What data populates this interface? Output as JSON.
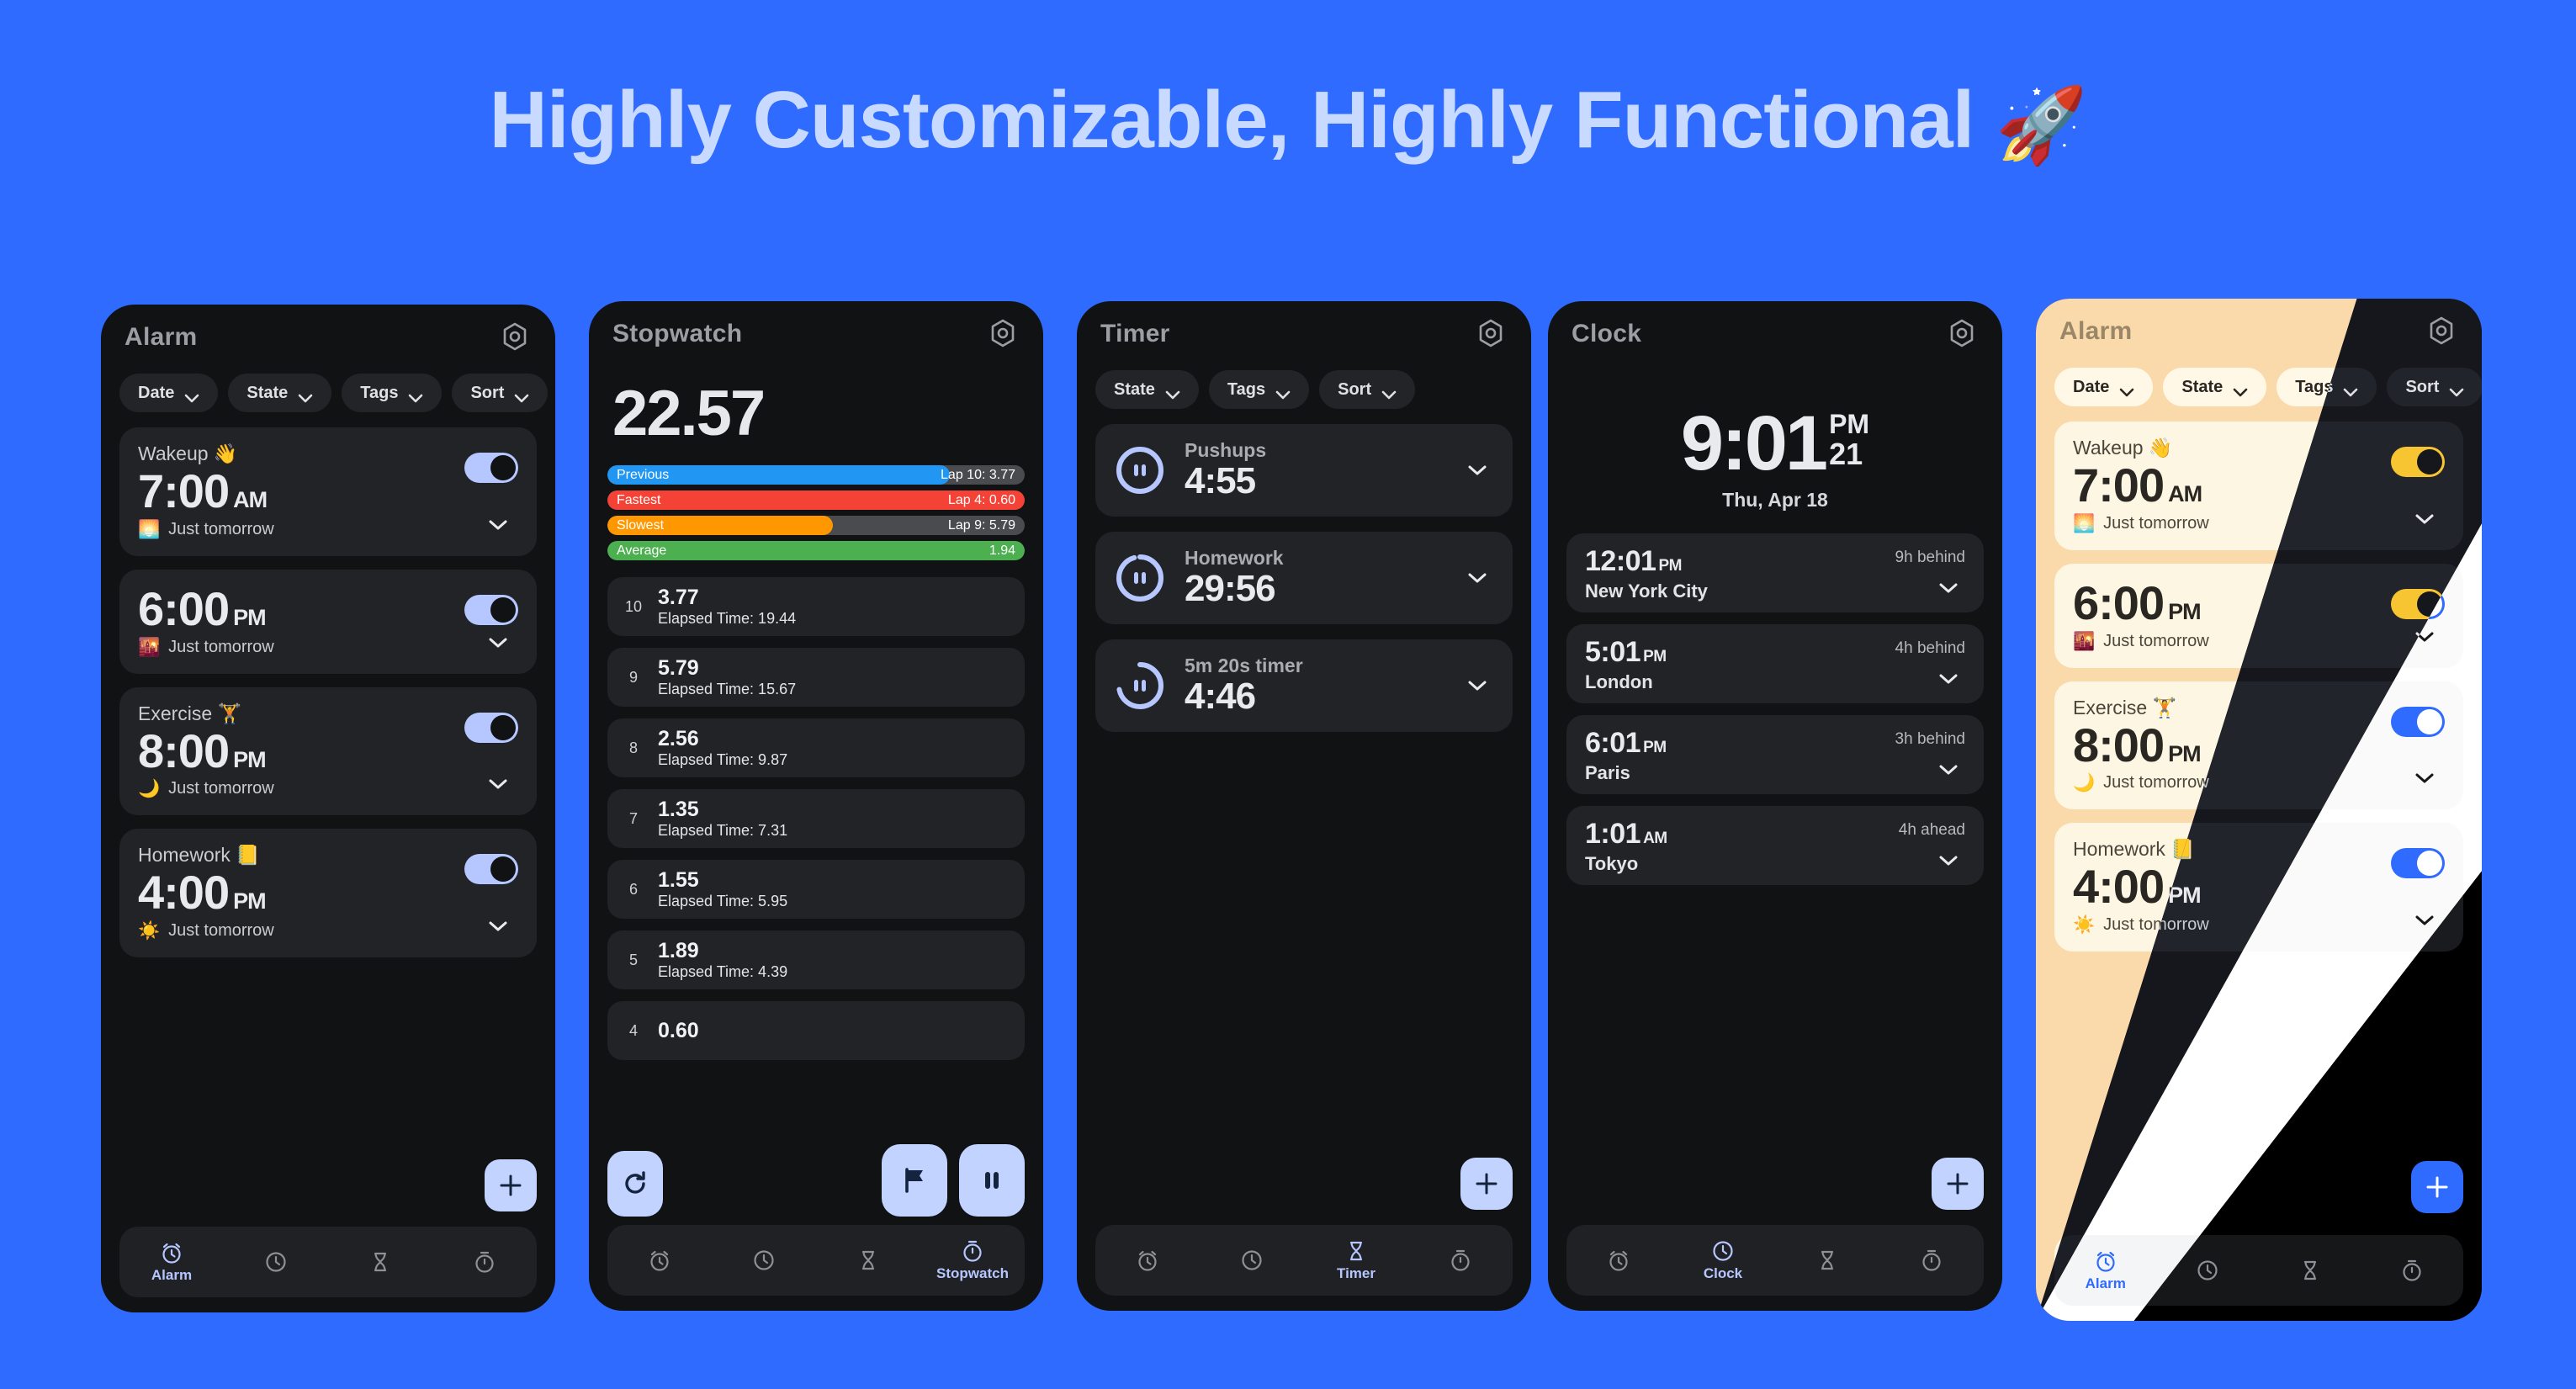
{
  "headline": {
    "text": "Highly Customizable, Highly Functional ",
    "emoji": "🚀"
  },
  "brand": {
    "background": "#2f6bff",
    "accent_light": "#c2d3ff",
    "accent_blue": "#2f6bff",
    "accent_yellow": "#f7c531"
  },
  "nav": {
    "items": [
      {
        "icon": "alarm-clock-icon",
        "label": "Alarm"
      },
      {
        "icon": "clock-icon",
        "label": "Clock"
      },
      {
        "icon": "hourglass-icon",
        "label": "Timer"
      },
      {
        "icon": "stopwatch-icon",
        "label": "Stopwatch"
      }
    ]
  },
  "alarm_screen": {
    "title": "Alarm",
    "settings_icon": "gear-icon",
    "chips": [
      {
        "label": "Date",
        "icon": "chevron-down-icon"
      },
      {
        "label": "State",
        "icon": "chevron-down-icon"
      },
      {
        "label": "Tags",
        "icon": "chevron-down-icon"
      },
      {
        "label": "Sort",
        "icon": "chevron-down-icon"
      }
    ],
    "alarms": [
      {
        "label": "Wakeup 👋",
        "time": "7:00",
        "meridiem": "AM",
        "sub_icon": "🌅",
        "sub": "Just tomorrow",
        "enabled": true
      },
      {
        "label": "",
        "time": "6:00",
        "meridiem": "PM",
        "sub_icon": "🌇",
        "sub": "Just tomorrow",
        "enabled": true
      },
      {
        "label": "Exercise 🏋️",
        "time": "8:00",
        "meridiem": "PM",
        "sub_icon": "🌙",
        "sub": "Just tomorrow",
        "enabled": true
      },
      {
        "label": "Homework 📒",
        "time": "4:00",
        "meridiem": "PM",
        "sub_icon": "☀️",
        "sub": "Just tomorrow",
        "enabled": true
      }
    ],
    "add_button": "add-alarm-button",
    "active_nav": "Alarm"
  },
  "stopwatch_screen": {
    "title": "Stopwatch",
    "settings_icon": "gear-icon",
    "elapsed": "22.57",
    "bars": [
      {
        "name": "Previous",
        "value": "Lap 10: 3.77",
        "color": "#2196f3",
        "fill_pct": 82
      },
      {
        "name": "Fastest",
        "value": "Lap 4: 0.60",
        "color": "#f44336",
        "fill_pct": 100
      },
      {
        "name": "Slowest",
        "value": "Lap 9: 5.79",
        "color": "#ff9800",
        "fill_pct": 54
      },
      {
        "name": "Average",
        "value": "1.94",
        "color": "#4caf50",
        "fill_pct": 100
      }
    ],
    "laps": [
      {
        "num": "10",
        "value": "3.77",
        "elapsed": "Elapsed Time: 19.44"
      },
      {
        "num": "9",
        "value": "5.79",
        "elapsed": "Elapsed Time: 15.67"
      },
      {
        "num": "8",
        "value": "2.56",
        "elapsed": "Elapsed Time: 9.87"
      },
      {
        "num": "7",
        "value": "1.35",
        "elapsed": "Elapsed Time: 7.31"
      },
      {
        "num": "6",
        "value": "1.55",
        "elapsed": "Elapsed Time: 5.95"
      },
      {
        "num": "5",
        "value": "1.89",
        "elapsed": "Elapsed Time: 4.39"
      },
      {
        "num": "4",
        "value": "0.60",
        "elapsed": ""
      }
    ],
    "buttons": [
      {
        "name": "reset-button",
        "icon": "refresh-icon"
      },
      {
        "name": "lap-button",
        "icon": "flag-icon"
      },
      {
        "name": "pause-button",
        "icon": "pause-icon"
      }
    ],
    "active_nav": "Stopwatch"
  },
  "timer_screen": {
    "title": "Timer",
    "settings_icon": "gear-icon",
    "chips": [
      {
        "label": "State",
        "icon": "chevron-down-icon"
      },
      {
        "label": "Tags",
        "icon": "chevron-down-icon"
      },
      {
        "label": "Sort",
        "icon": "chevron-down-icon"
      }
    ],
    "timers": [
      {
        "name": "Pushups",
        "time": "4:55",
        "state_icon": "pause-ring-icon",
        "progress_pct": 78
      },
      {
        "name": "Homework",
        "time": "29:56",
        "state_icon": "pause-ring-icon",
        "progress_pct": 96
      },
      {
        "name": "5m 20s timer",
        "time": "4:46",
        "state_icon": "pause-ring-icon",
        "progress_pct": 72
      }
    ],
    "add_button": "add-timer-button",
    "active_nav": "Timer"
  },
  "clock_screen": {
    "title": "Clock",
    "settings_icon": "gear-icon",
    "time": "9:01",
    "meridiem": "PM",
    "seconds": "21",
    "date": "Thu, Apr 18",
    "world_clocks": [
      {
        "time": "12:01",
        "meridiem": "PM",
        "city": "New York City",
        "offset": "9h behind"
      },
      {
        "time": "5:01",
        "meridiem": "PM",
        "city": "London",
        "offset": "4h behind"
      },
      {
        "time": "6:01",
        "meridiem": "PM",
        "city": "Paris",
        "offset": "3h behind"
      },
      {
        "time": "1:01",
        "meridiem": "AM",
        "city": "Tokyo",
        "offset": "4h ahead"
      }
    ],
    "add_button": "add-world-clock-button",
    "active_nav": "Clock"
  },
  "themed_alarm_screen": {
    "title": "Alarm",
    "settings_icon": "gear-icon",
    "chips": [
      {
        "label": "Date",
        "icon": "chevron-down-icon"
      },
      {
        "label": "State",
        "icon": "chevron-down-icon"
      },
      {
        "label": "Tags",
        "icon": "chevron-down-icon"
      },
      {
        "label": "Sort",
        "icon": "chevron-down-icon"
      }
    ],
    "alarms": [
      {
        "label": "Wakeup 👋",
        "time": "7:00",
        "meridiem": "AM",
        "sub_icon": "🌅",
        "sub": "Just tomorrow",
        "enabled": true
      },
      {
        "label": "",
        "time": "6:00",
        "meridiem": "PM",
        "sub_icon": "🌇",
        "sub": "Just tomorrow",
        "enabled": true
      },
      {
        "label": "Exercise 🏋️",
        "time": "8:00",
        "meridiem": "PM",
        "sub_icon": "🌙",
        "sub": "Just tomorrow",
        "enabled": true
      },
      {
        "label": "Homework 📒",
        "time": "4:00",
        "meridiem": "PM",
        "sub_icon": "☀️",
        "sub": "Just tomorrow",
        "enabled": true
      }
    ],
    "add_button": "add-alarm-button",
    "active_nav": "Alarm",
    "themes": [
      "cream",
      "navy",
      "white",
      "black"
    ]
  }
}
